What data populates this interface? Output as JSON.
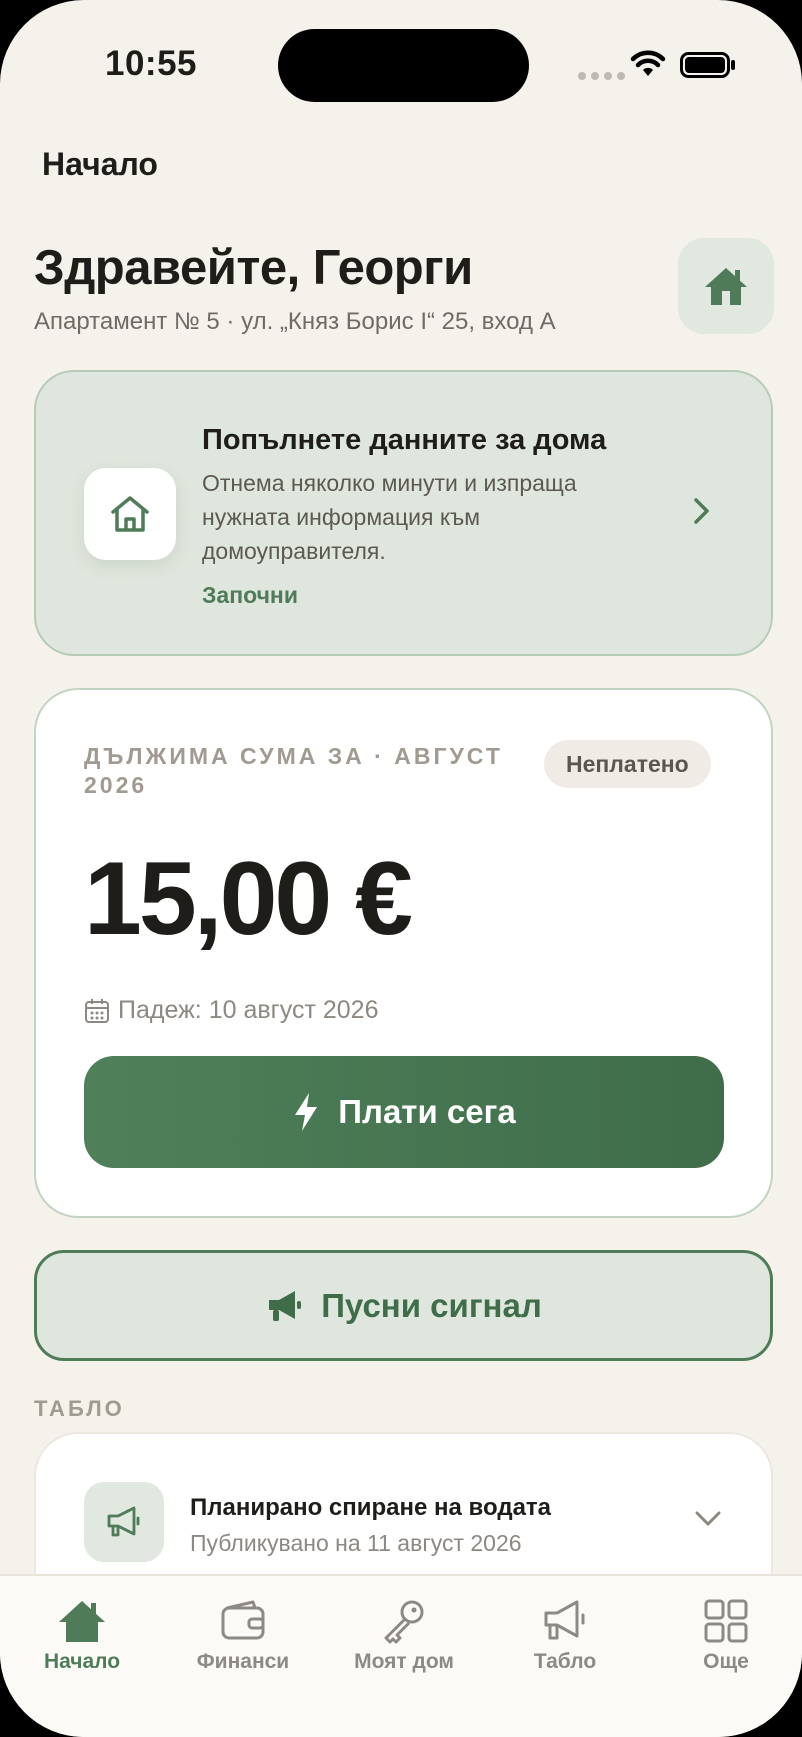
{
  "status_bar": {
    "time": "10:55"
  },
  "nav": {
    "title": "Начало"
  },
  "greeting": {
    "title": "Здравейте, Георги",
    "address": "Апартамент № 5 · ул. „Княз Борис I“ 25, вход А",
    "home_icon": "house-icon"
  },
  "onboarding": {
    "title": "Попълнете данните за дома",
    "text": "Отнема няколко минути и изпраща нужната информация към домоуправителя.",
    "action": "Започни",
    "icon": "house-outline-icon"
  },
  "payment": {
    "label": "ДЪЛЖИМА СУМА ЗА · АВГУСТ 2026",
    "status": "Неплатено",
    "amount": "15,00 €",
    "due": "Падеж: 10 август 2026",
    "pay_label": "Плати сега"
  },
  "signal": {
    "label": "Пусни сигнал"
  },
  "board": {
    "heading": "ТАБЛО",
    "items": [
      {
        "title": "Планирано спиране на водата",
        "subtitle": "Публикувано на 11 август 2026"
      }
    ]
  },
  "tabs": [
    {
      "label": "Начало",
      "icon": "house-icon",
      "active": true
    },
    {
      "label": "Финанси",
      "icon": "wallet-icon",
      "active": false
    },
    {
      "label": "Моят дом",
      "icon": "key-icon",
      "active": false
    },
    {
      "label": "Табло",
      "icon": "megaphone-icon",
      "active": false
    },
    {
      "label": "Още",
      "icon": "grid-icon",
      "active": false
    }
  ],
  "colors": {
    "accent": "#4f7b59",
    "background": "#f5f2eb",
    "card_tint": "#dfe6dd"
  }
}
